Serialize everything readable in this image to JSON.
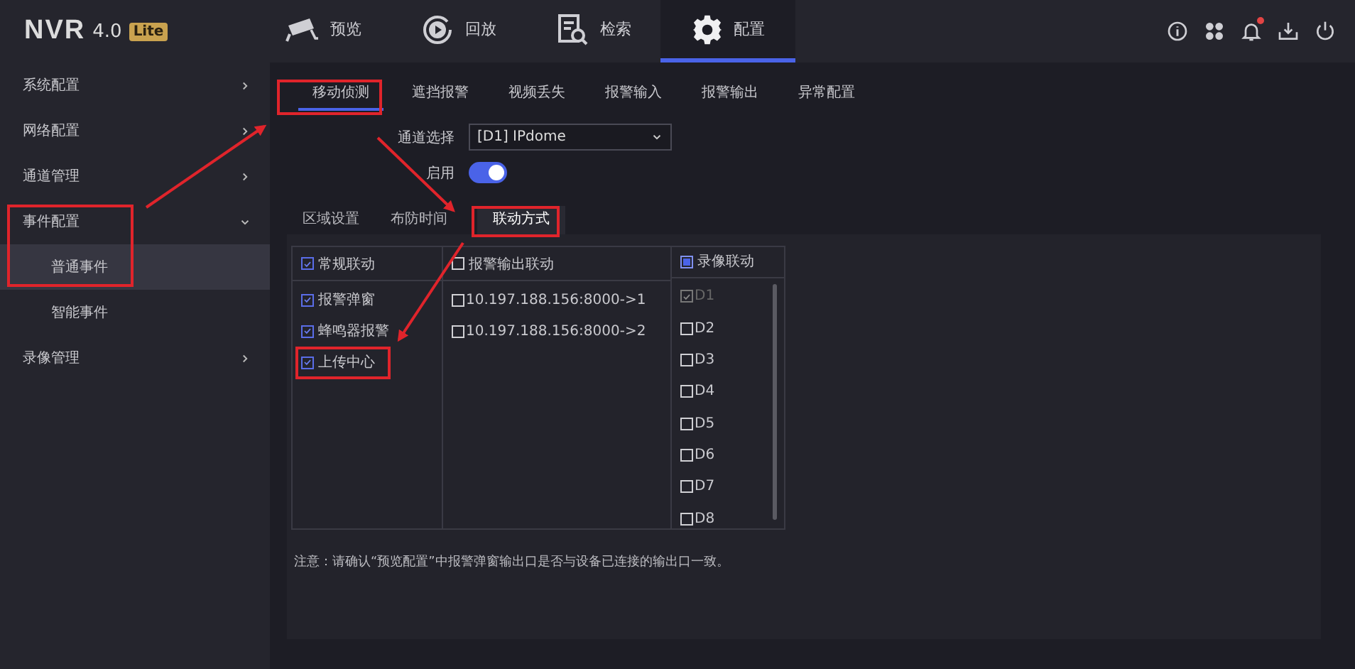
{
  "logo": {
    "name": "NVR",
    "version": "4.0",
    "edition": "Lite"
  },
  "nav": [
    {
      "label": "预览",
      "selected": false
    },
    {
      "label": "回放",
      "selected": false
    },
    {
      "label": "检索",
      "selected": false
    },
    {
      "label": "配置",
      "selected": true
    }
  ],
  "toolbar": [
    {
      "badge": false
    },
    {
      "badge": false
    },
    {
      "badge": true
    },
    {
      "badge": false
    },
    {
      "badge": false
    }
  ],
  "sidebar": {
    "items": [
      {
        "label": "系统配置",
        "expanded": false,
        "selected": false
      },
      {
        "label": "网络配置",
        "expanded": false,
        "selected": false
      },
      {
        "label": "通道管理",
        "expanded": false,
        "selected": false
      },
      {
        "label": "事件配置",
        "expanded": true,
        "selected": false,
        "children": [
          {
            "label": "普通事件",
            "selected": true
          },
          {
            "label": "智能事件",
            "selected": false
          }
        ]
      },
      {
        "label": "录像管理",
        "expanded": false,
        "selected": false
      }
    ]
  },
  "tabs": [
    {
      "label": "移动侦测",
      "selected": true
    },
    {
      "label": "遮挡报警",
      "selected": false
    },
    {
      "label": "视频丢失",
      "selected": false
    },
    {
      "label": "报警输入",
      "selected": false
    },
    {
      "label": "报警输出",
      "selected": false
    },
    {
      "label": "异常配置",
      "selected": false
    }
  ],
  "channel": {
    "label": "通道选择",
    "value": "[D1] IPdome"
  },
  "enable": {
    "label": "启用",
    "on": true
  },
  "subtabs": [
    {
      "label": "区域设置",
      "selected": false
    },
    {
      "label": "布防时间",
      "selected": false
    },
    {
      "label": "联动方式",
      "selected": true
    }
  ],
  "linkage": [
    {
      "title": "常规联动",
      "checked": true,
      "items": [
        {
          "label": "报警弹窗",
          "checked": true,
          "disabled": false
        },
        {
          "label": "蜂鸣器报警",
          "checked": true,
          "disabled": false
        },
        {
          "label": "上传中心",
          "checked": true,
          "disabled": false
        }
      ]
    },
    {
      "title": "报警输出联动",
      "checked": false,
      "items": [
        {
          "label": "10.197.188.156:8000->1",
          "checked": false,
          "disabled": false
        },
        {
          "label": "10.197.188.156:8000->2",
          "checked": false,
          "disabled": false
        }
      ]
    },
    {
      "title": "录像联动",
      "checked": false,
      "mixed": true,
      "items": [
        {
          "label": "D1",
          "checked": true,
          "disabled": true
        },
        {
          "label": "D2",
          "checked": false,
          "disabled": false
        },
        {
          "label": "D3",
          "checked": false,
          "disabled": false
        },
        {
          "label": "D4",
          "checked": false,
          "disabled": false
        },
        {
          "label": "D5",
          "checked": false,
          "disabled": false
        },
        {
          "label": "D6",
          "checked": false,
          "disabled": false
        },
        {
          "label": "D7",
          "checked": false,
          "disabled": false
        },
        {
          "label": "D8",
          "checked": false,
          "disabled": false
        }
      ]
    }
  ],
  "note": "注意：请确认“预览配置”中报警弹窗输出口是否与设备已连接的输出口一致。"
}
